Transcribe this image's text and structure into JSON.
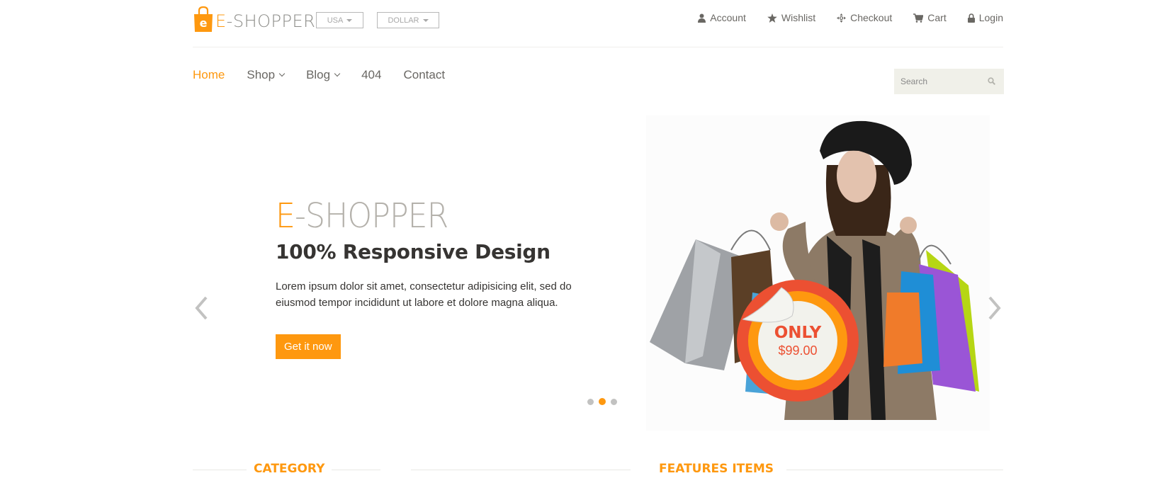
{
  "header": {
    "logo": {
      "letter": "e",
      "brand_first": "E",
      "brand_rest": "-SHOPPER"
    },
    "country": {
      "selected": "USA"
    },
    "currency": {
      "selected": "DOLLAR"
    },
    "topnav": [
      {
        "label": "Account",
        "icon": "user-icon"
      },
      {
        "label": "Wishlist",
        "icon": "star-icon"
      },
      {
        "label": "Checkout",
        "icon": "crosshair-icon"
      },
      {
        "label": "Cart",
        "icon": "cart-icon"
      },
      {
        "label": "Login",
        "icon": "lock-icon"
      }
    ]
  },
  "mainnav": {
    "items": [
      {
        "label": "Home",
        "active": true,
        "dropdown": false
      },
      {
        "label": "Shop",
        "active": false,
        "dropdown": true
      },
      {
        "label": "Blog",
        "active": false,
        "dropdown": true
      },
      {
        "label": "404",
        "active": false,
        "dropdown": false
      },
      {
        "label": "Contact",
        "active": false,
        "dropdown": false
      }
    ]
  },
  "search": {
    "placeholder": "Search"
  },
  "slider": {
    "brand_first": "E",
    "brand_rest": "-SHOPPER",
    "headline": "100% Responsive Design",
    "description": "Lorem ipsum dolor sit amet, consectetur adipisicing elit, sed do eiusmod tempor incididunt ut labore et dolore magna aliqua.",
    "cta": "Get it now",
    "badge": {
      "line1": "ONLY",
      "line2": "$99.00"
    },
    "active_dot": 1,
    "dot_count": 3
  },
  "sections": {
    "category": "CATEGORY",
    "features": "FEATURES ITEMS"
  },
  "colors": {
    "accent": "#FE980F",
    "text": "#696763",
    "dark": "#363432",
    "badge_red": "#ec5032",
    "search_bg": "#F0F0E9"
  }
}
